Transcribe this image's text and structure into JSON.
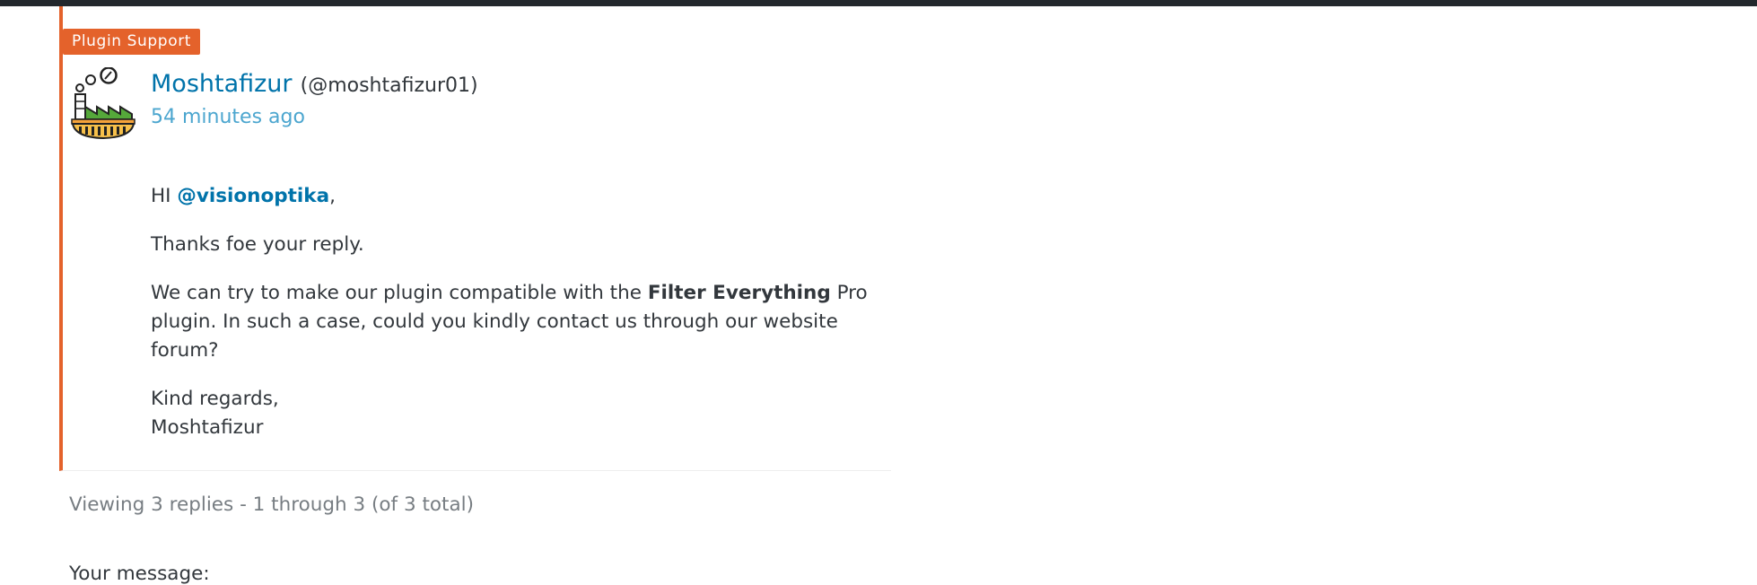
{
  "reply": {
    "badge": "Plugin Support",
    "author": {
      "name": "Moshtafizur",
      "handle": "(@moshtafizur01)",
      "avatar_icon": "factory-avatar-icon"
    },
    "timestamp": "54 minutes ago",
    "content": {
      "greeting_prefix": "HI ",
      "mention": "@visionoptika",
      "greeting_suffix": ",",
      "p2": "Thanks foe your reply.",
      "p3_before": "We can try to make our plugin compatible with the ",
      "p3_bold": "Filter Everything",
      "p3_after": " Pro plugin. In such a case, could you kindly contact us through our website forum?",
      "closing": "Kind regards,",
      "signature": "Moshtafizur"
    }
  },
  "pagination": {
    "text": "Viewing 3 replies - 1 through 3 (of 3 total)"
  },
  "form": {
    "message_label": "Your message:"
  },
  "colors": {
    "accent": "#e4622b",
    "link": "#0073aa",
    "timestamp": "#4ca6cf",
    "text": "#32373c",
    "muted": "#777d82",
    "topbar": "#23282d"
  }
}
